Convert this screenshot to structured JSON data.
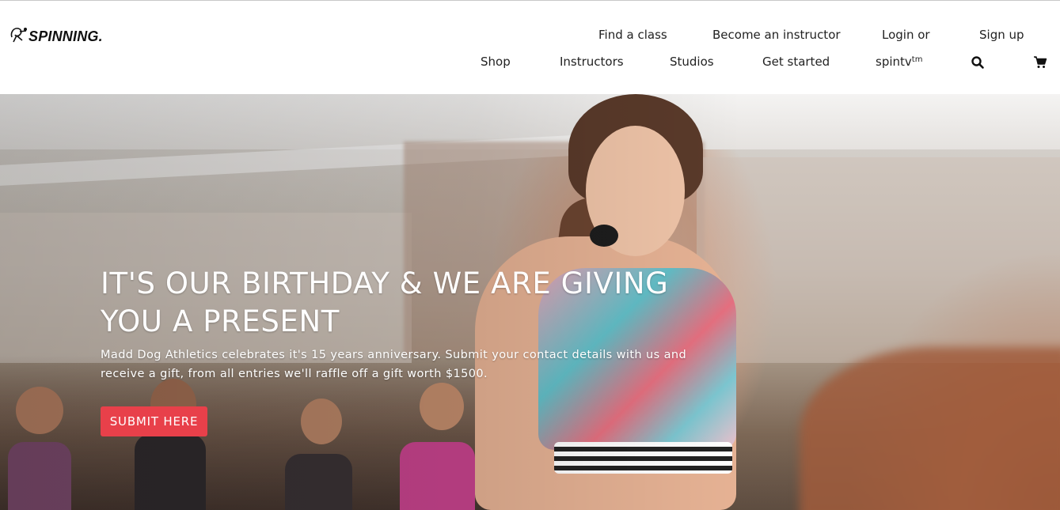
{
  "logo": {
    "text": "SPINNING."
  },
  "nav": {
    "top_row": {
      "find_class": "Find a class",
      "become_instructor": "Become an instructor",
      "login": "Login or",
      "signup": "Sign up"
    },
    "bottom_row": {
      "shop": "Shop",
      "instructors": "Instructors",
      "studios": "Studios",
      "get_started": "Get started",
      "spintv": "spintv",
      "spintv_sup": "tm"
    },
    "icons": {
      "search": "search-icon",
      "cart": "cart-icon"
    }
  },
  "hero": {
    "title": "IT'S OUR BIRTHDAY & WE ARE GIVING YOU A PRESENT",
    "text": "Madd Dog Athletics celebrates it's 15 years anniversary. Submit your contact details with us and receive a gift, from all entries we'll raffle off a gift worth $1500.",
    "cta_label": "SUBMIT HERE",
    "cta_color": "#e8404a"
  }
}
